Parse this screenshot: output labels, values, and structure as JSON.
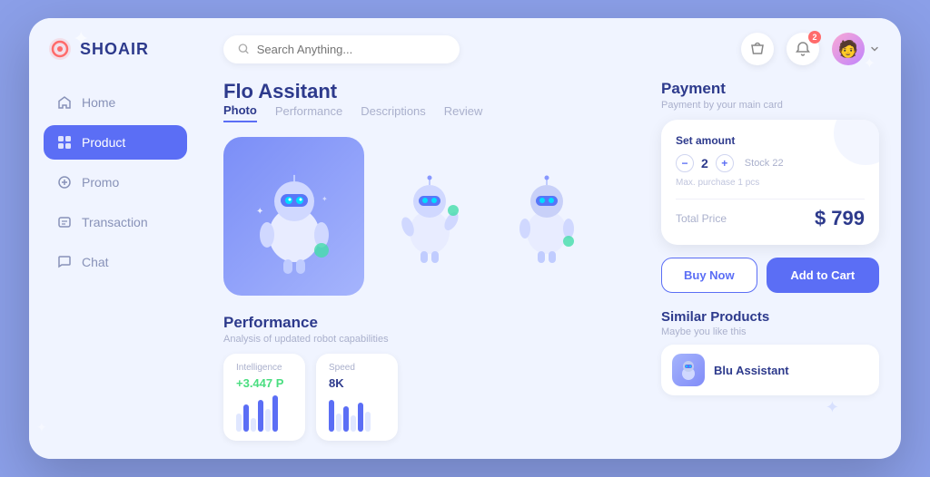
{
  "logo": {
    "text": "SHOAIR"
  },
  "nav": {
    "items": [
      {
        "id": "home",
        "label": "Home",
        "active": false
      },
      {
        "id": "product",
        "label": "Product",
        "active": true
      },
      {
        "id": "promo",
        "label": "Promo",
        "active": false
      },
      {
        "id": "transaction",
        "label": "Transaction",
        "active": false
      },
      {
        "id": "chat",
        "label": "Chat",
        "active": false
      }
    ]
  },
  "header": {
    "search_placeholder": "Search Anything...",
    "notification_badge": "2"
  },
  "product": {
    "title": "Flo Assitant",
    "tabs": [
      "Photo",
      "Performance",
      "Descriptions",
      "Review"
    ],
    "active_tab": "Photo"
  },
  "payment": {
    "title": "Payment",
    "subtitle": "Payment by your main card",
    "set_amount_label": "Set amount",
    "quantity": "2",
    "stock": "Stock 22",
    "max_purchase": "Max. purchase 1 pcs",
    "total_label": "Total Price",
    "total_price": "$ 799",
    "buy_now_label": "Buy Now",
    "add_to_cart_label": "Add to Cart"
  },
  "performance": {
    "title": "Performance",
    "subtitle": "Analysis of updated robot capabilities",
    "metrics": [
      {
        "label": "Intelligence",
        "value": "+3.447 P",
        "positive": true
      },
      {
        "label": "Speed",
        "value": "8K",
        "positive": false
      }
    ]
  },
  "similar": {
    "title": "Similar Products",
    "subtitle": "Maybe you like this",
    "items": [
      {
        "name": "Blu Assistant"
      }
    ]
  }
}
